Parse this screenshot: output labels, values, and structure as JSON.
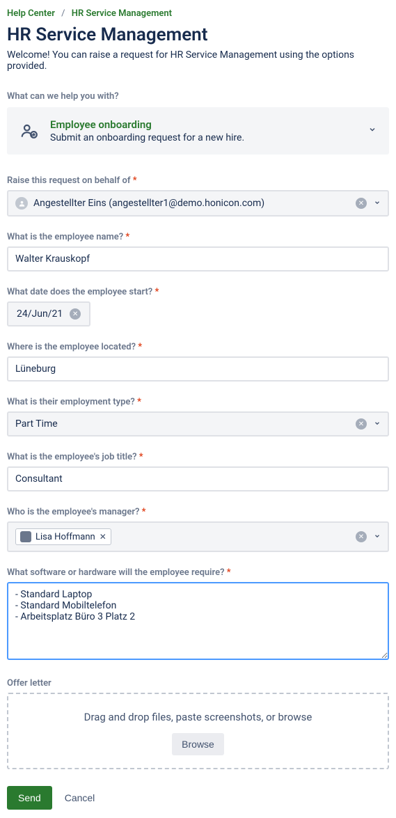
{
  "breadcrumb": {
    "help_center": "Help Center",
    "current": "HR Service Management"
  },
  "page_title": "HR Service Management",
  "welcome": "Welcome! You can raise a request for HR Service Management using the options provided.",
  "help_prompt": "What can we help you with?",
  "request_type": {
    "title": "Employee onboarding",
    "desc": "Submit an onboarding request for a new hire."
  },
  "fields": {
    "behalf": {
      "label": "Raise this request on behalf of",
      "value": "Angestellter Eins (angestellter1@demo.honicon.com)"
    },
    "employee_name": {
      "label": "What is the employee name?",
      "value": "Walter Krauskopf"
    },
    "start_date": {
      "label": "What date does the employee start?",
      "value": "24/Jun/21"
    },
    "location": {
      "label": "Where is the employee located?",
      "value": "Lüneburg"
    },
    "employment_type": {
      "label": "What is their employment type?",
      "value": "Part Time"
    },
    "job_title": {
      "label": "What is the employee's job title?",
      "value": "Consultant"
    },
    "manager": {
      "label": "Who is the employee's manager?",
      "value": "Lisa Hoffmann"
    },
    "requirements": {
      "label": "What software or hardware will the employee require?",
      "value": "- Standard Laptop\n- Standard Mobiltelefon\n- Arbeitsplatz Büro 3 Platz 2"
    },
    "offer_letter": {
      "label": "Offer letter",
      "dropzone_text": "Drag and drop files, paste screenshots, or browse",
      "browse": "Browse"
    }
  },
  "actions": {
    "send": "Send",
    "cancel": "Cancel"
  }
}
